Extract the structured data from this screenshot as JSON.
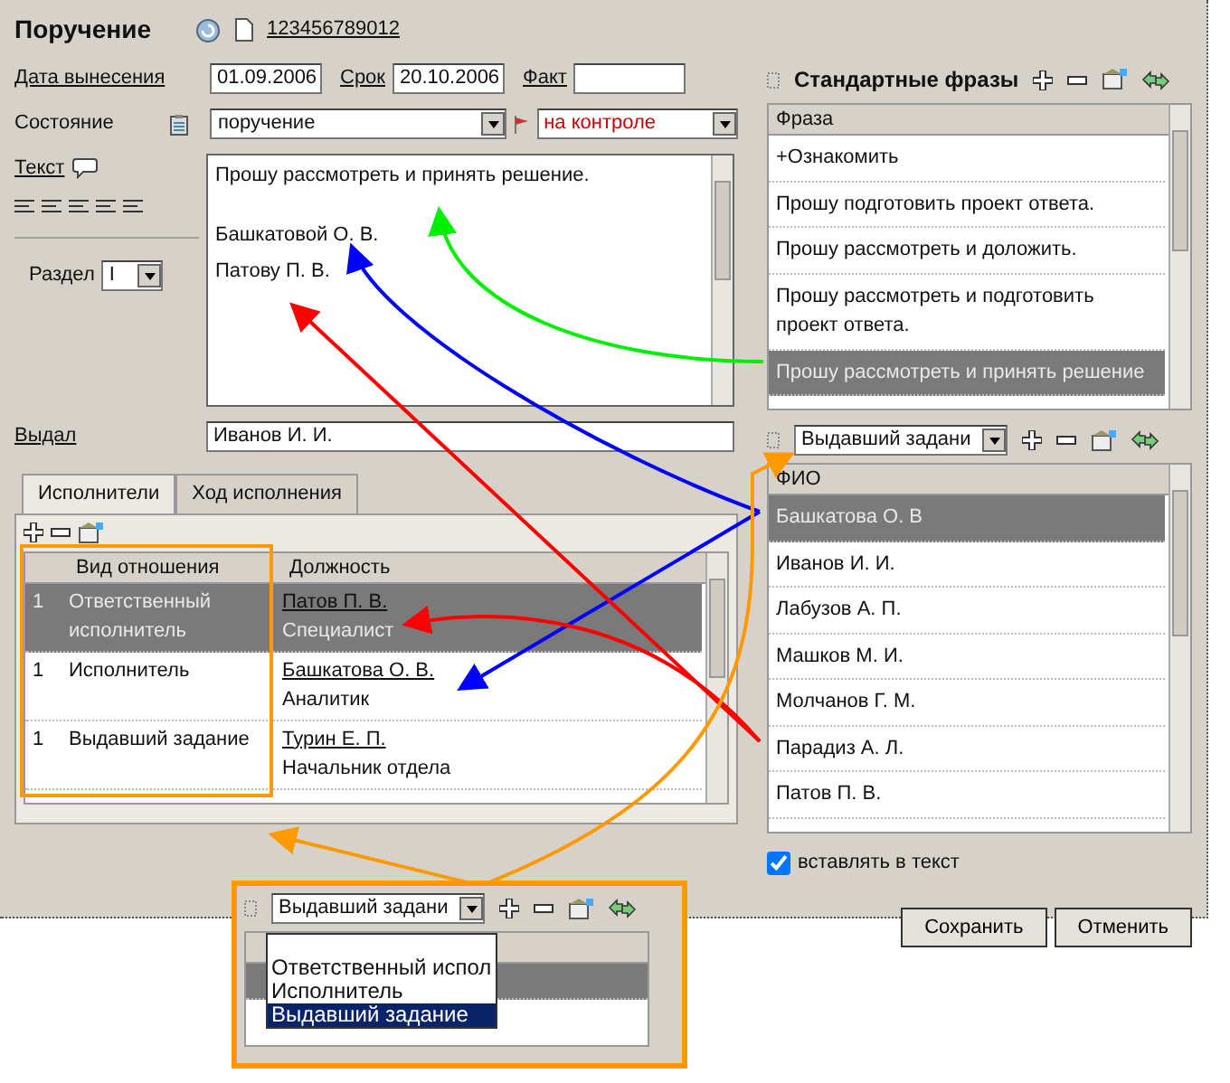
{
  "window": {
    "title": "Поручение",
    "number": "123456789012"
  },
  "dates": [
    {
      "label": "Дата вынесения",
      "value": "01.09.2006"
    },
    {
      "label": "Срок",
      "value": "20.10.2006"
    },
    {
      "label": "Факт"
    }
  ],
  "state": {
    "label": "Состояние",
    "value": "поручение",
    "control": "на контроле"
  },
  "text": {
    "label": "Текст",
    "body": "Прошу рассмотреть и принять решение.",
    "addressees": [
      "Башкатовой О. В.",
      "Патову П. В."
    ]
  },
  "section": {
    "label": "Раздел",
    "value": "I"
  },
  "issuer": {
    "label": "Выдал",
    "value": "Иванов И. И."
  },
  "tabs": [
    {
      "label": "Исполнители",
      "selected": true
    },
    {
      "label": "Ход исполнения",
      "selected": false
    }
  ],
  "executors": {
    "columns": [
      "Вид отношения",
      "Должность"
    ],
    "rows": [
      {
        "count": "1",
        "relation": "Ответственный исполнитель",
        "name": "Патов П. В.",
        "position": "Специалист",
        "selected": true
      },
      {
        "count": "1",
        "relation": "Исполнитель",
        "name": "Башкатова О. В.",
        "position": "Аналитик",
        "selected": false
      },
      {
        "count": "1",
        "relation": "Выдавший задание",
        "name": "Турин Е. П.",
        "position": "Начальник отдела",
        "selected": false
      }
    ]
  },
  "phrases": {
    "title": "Стандартные фразы",
    "column": "Фраза",
    "items": [
      {
        "text": "+Ознакомить",
        "selected": false
      },
      {
        "text": "Прошу подготовить проект ответа.",
        "selected": false
      },
      {
        "text": "Прошу рассмотреть и доложить.",
        "selected": false
      },
      {
        "text": "Прошу рассмотреть и подготовить проект ответа.",
        "selected": false
      },
      {
        "text": "Прошу рассмотреть и принять решение",
        "selected": true
      }
    ]
  },
  "people": {
    "filter": "Выдавший задани",
    "column": "ФИО",
    "items": [
      {
        "text": "Башкатова О. В",
        "selected": true
      },
      {
        "text": "Иванов И. И.",
        "selected": false
      },
      {
        "text": "Лабузов А. П.",
        "selected": false
      },
      {
        "text": "Машков М. И.",
        "selected": false
      },
      {
        "text": "Молчанов Г. М.",
        "selected": false
      },
      {
        "text": "Парадиз А. Л.",
        "selected": false
      },
      {
        "text": "Патов П. В.",
        "selected": false
      }
    ]
  },
  "insert_checkbox": {
    "label": "вставлять в текст",
    "checked": true
  },
  "buttons": [
    "Сохранить",
    "Отменить"
  ],
  "inset": {
    "filter": "Выдавший задани",
    "options": [
      {
        "text": "Ответственный испол",
        "selected": false
      },
      {
        "text": "Исполнитель",
        "selected": false
      },
      {
        "text": "Выдавший задание",
        "selected": true
      }
    ]
  },
  "arrows": [
    {
      "color": "#00ee00"
    },
    {
      "color": "#0000ff"
    },
    {
      "color": "#0000ff"
    },
    {
      "color": "#ff0000"
    },
    {
      "color": "#ff0000"
    },
    {
      "color": "#ff9900"
    },
    {
      "color": "#ff9900"
    }
  ]
}
